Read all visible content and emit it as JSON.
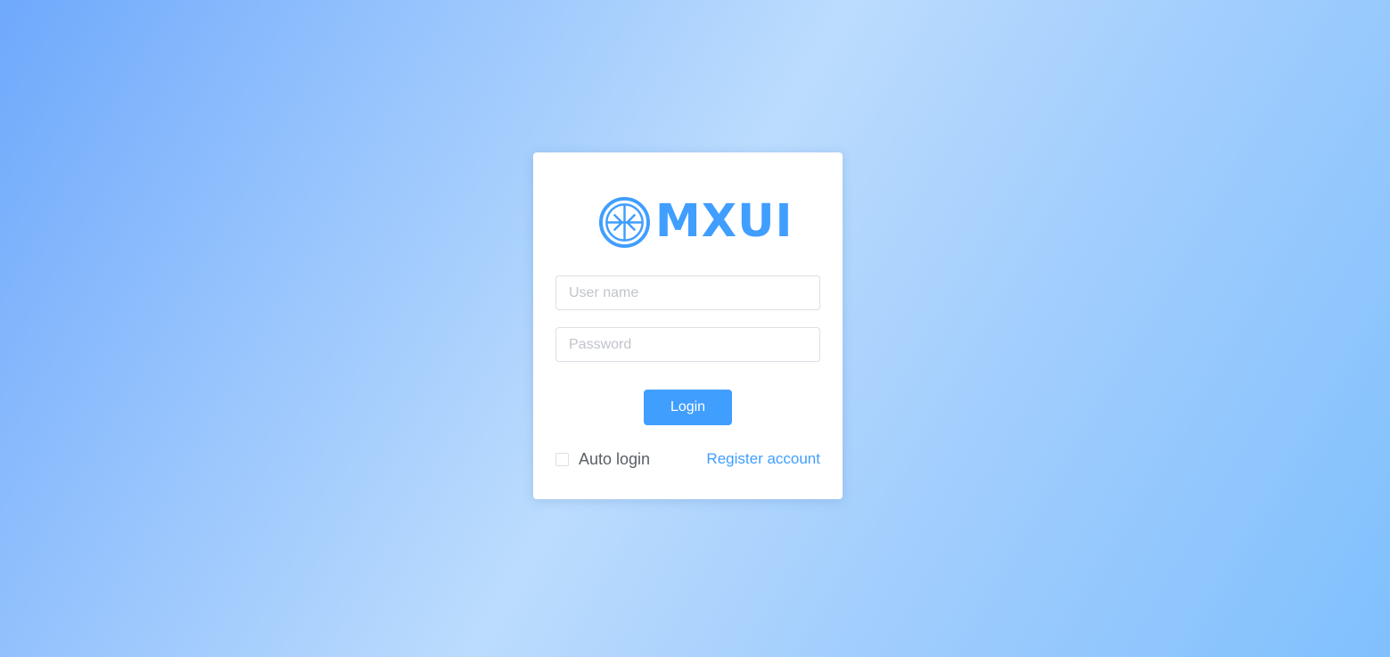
{
  "logo": {
    "text": "MXUI",
    "icon": "mxui-logo-icon",
    "color": "#409eff"
  },
  "form": {
    "username_placeholder": "User name",
    "username_value": "",
    "password_placeholder": "Password",
    "password_value": "",
    "login_label": "Login",
    "auto_login_label": "Auto login",
    "auto_login_checked": false,
    "register_label": "Register account"
  },
  "colors": {
    "accent": "#409eff",
    "border": "#dcdfe6",
    "placeholder": "#c0c4cc",
    "background_start": "#6fa9fc",
    "background_end": "#80c0fd"
  }
}
